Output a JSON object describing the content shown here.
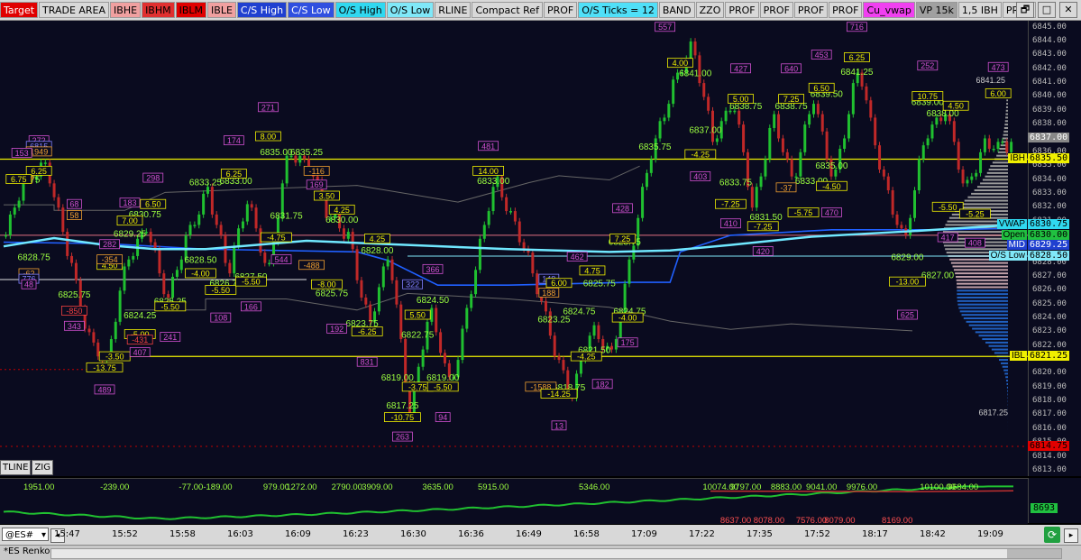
{
  "toolbar": [
    {
      "label": "Target",
      "bg": "#e00000",
      "fg": "#ffffff"
    },
    {
      "label": "TRADE AREA",
      "bg": "#d8d8d8",
      "fg": "#000"
    },
    {
      "label": "IBHE",
      "bg": "#f0a0a0",
      "fg": "#000"
    },
    {
      "label": "IBHM",
      "bg": "#e03030",
      "fg": "#000"
    },
    {
      "label": "IBLM",
      "bg": "#e00000",
      "fg": "#000"
    },
    {
      "label": "IBLE",
      "bg": "#f0a0a0",
      "fg": "#000"
    },
    {
      "label": "C/S High",
      "bg": "#2040d0",
      "fg": "#ffffff"
    },
    {
      "label": "C/S Low",
      "bg": "#3050e0",
      "fg": "#ffffff"
    },
    {
      "label": "O/S High",
      "bg": "#30d8f0",
      "fg": "#000"
    },
    {
      "label": "O/S Low",
      "bg": "#80e8f8",
      "fg": "#000"
    },
    {
      "label": "RLINE",
      "bg": "#d8d8d8",
      "fg": "#000"
    },
    {
      "label": "Compact Ref",
      "bg": "#d8d8d8",
      "fg": "#000"
    },
    {
      "label": "PROF",
      "bg": "#d8d8d8",
      "fg": "#000"
    },
    {
      "label": "O/S Ticks = 12",
      "bg": "#50e0f8",
      "fg": "#000"
    },
    {
      "label": "BAND",
      "bg": "#d8d8d8",
      "fg": "#000"
    },
    {
      "label": "ZZO",
      "bg": "#d8d8d8",
      "fg": "#000"
    },
    {
      "label": "PROF",
      "bg": "#d8d8d8",
      "fg": "#000"
    },
    {
      "label": "PROF",
      "bg": "#d8d8d8",
      "fg": "#000"
    },
    {
      "label": "PROF",
      "bg": "#d8d8d8",
      "fg": "#000"
    },
    {
      "label": "PROF",
      "bg": "#d8d8d8",
      "fg": "#000"
    },
    {
      "label": "Cu_vwap",
      "bg": "#f040f0",
      "fg": "#000"
    },
    {
      "label": "VP 15k",
      "bg": "#a0a0a0",
      "fg": "#000"
    },
    {
      "label": "1,5 IBH",
      "bg": "#d8d8d8",
      "fg": "#000"
    },
    {
      "label": "PROF",
      "bg": "#d8d8d8",
      "fg": "#000"
    }
  ],
  "window_controls": {
    "restore": "🗗",
    "maximize": "□",
    "close": "✕"
  },
  "price_axis": {
    "ticks": [
      "6845.00",
      "6844.00",
      "6843.00",
      "6842.00",
      "6841.00",
      "6840.00",
      "6839.00",
      "6838.00",
      "6837.00",
      "6836.00",
      "6835.00",
      "6834.00",
      "6833.00",
      "6832.00",
      "6831.00",
      "6830.00",
      "6829.00",
      "6828.00",
      "6827.00",
      "6826.00",
      "6825.00",
      "6824.00",
      "6823.00",
      "6822.00",
      "6821.00",
      "6820.00",
      "6819.00",
      "6818.00",
      "6817.00",
      "6816.00",
      "6815.00",
      "6814.00",
      "6813.00"
    ]
  },
  "price_labels": [
    {
      "tag": "",
      "value": "6837.00",
      "bg": "#888",
      "fg": "#fff",
      "price": 6837
    },
    {
      "tag": "IBH",
      "value": "6835.50",
      "bg": "#f0f000",
      "fg": "#000",
      "price": 6835.5
    },
    {
      "tag": "VWAP",
      "value": "6830.75",
      "bg": "#30d8f0",
      "fg": "#000",
      "price": 6830.75
    },
    {
      "tag": "Open",
      "value": "6830.00",
      "bg": "#20c040",
      "fg": "#000",
      "price": 6830
    },
    {
      "tag": "MID",
      "value": "6829.25",
      "bg": "#2040d0",
      "fg": "#fff",
      "price": 6829.25
    },
    {
      "tag": "O/S Low",
      "value": "6828.50",
      "bg": "#80e8f8",
      "fg": "#000",
      "price": 6828.5
    },
    {
      "tag": "IBL",
      "value": "6821.25",
      "bg": "#f0f000",
      "fg": "#000",
      "price": 6821.25
    },
    {
      "tag": "",
      "value": "6814.75",
      "bg": "#e00000",
      "fg": "#000",
      "price": 6814.75
    }
  ],
  "right_notes": {
    "high": "6841.25",
    "low": "6817.25"
  },
  "swing_labels": [
    {
      "text": "6835.00",
      "price": 6835.8,
      "t": 0.03
    },
    {
      "text": "6832.75",
      "price": 6833.8,
      "t": 0.02
    },
    {
      "text": "6829.25",
      "price": 6829.9,
      "t": 0.125
    },
    {
      "text": "6830.75",
      "price": 6831.3,
      "t": 0.14
    },
    {
      "text": "6828.75",
      "price": 6828.2,
      "t": 0.03
    },
    {
      "text": "6825.75",
      "price": 6825.5,
      "t": 0.07
    },
    {
      "text": "6824.25",
      "price": 6824.0,
      "t": 0.135
    },
    {
      "text": "6825.25",
      "price": 6825.0,
      "t": 0.165
    },
    {
      "text": "6833.25",
      "price": 6833.6,
      "t": 0.2
    },
    {
      "text": "6833.00",
      "price": 6833.7,
      "t": 0.23
    },
    {
      "text": "6828.50",
      "price": 6828.0,
      "t": 0.195
    },
    {
      "text": "6826.75",
      "price": 6826.3,
      "t": 0.22
    },
    {
      "text": "6827.50",
      "price": 6826.8,
      "t": 0.245
    },
    {
      "text": "6835.00",
      "price": 6835.8,
      "t": 0.27
    },
    {
      "text": "6835.25",
      "price": 6835.8,
      "t": 0.3
    },
    {
      "text": "6831.75",
      "price": 6831.2,
      "t": 0.28
    },
    {
      "text": "6830.00",
      "price": 6830.9,
      "t": 0.335
    },
    {
      "text": "6828.00",
      "price": 6828.7,
      "t": 0.37
    },
    {
      "text": "6825.75",
      "price": 6825.6,
      "t": 0.325
    },
    {
      "text": "6823.75",
      "price": 6823.4,
      "t": 0.355
    },
    {
      "text": "6833.00",
      "price": 6833.7,
      "t": 0.485
    },
    {
      "text": "6824.50",
      "price": 6825.1,
      "t": 0.425
    },
    {
      "text": "6822.75",
      "price": 6822.6,
      "t": 0.41
    },
    {
      "text": "6819.00",
      "price": 6819.5,
      "t": 0.39
    },
    {
      "text": "6819.00",
      "price": 6819.5,
      "t": 0.435
    },
    {
      "text": "6817.25",
      "price": 6817.5,
      "t": 0.395
    },
    {
      "text": "6825.75",
      "price": 6826.3,
      "t": 0.59
    },
    {
      "text": "6823.25",
      "price": 6823.7,
      "t": 0.545
    },
    {
      "text": "6824.75",
      "price": 6824.3,
      "t": 0.57
    },
    {
      "text": "6828.75",
      "price": 6829.3,
      "t": 0.615
    },
    {
      "text": "6824.75",
      "price": 6824.3,
      "t": 0.62
    },
    {
      "text": "6821.50",
      "price": 6821.5,
      "t": 0.585
    },
    {
      "text": "6818.75",
      "price": 6818.8,
      "t": 0.56
    },
    {
      "text": "6835.75",
      "price": 6836.2,
      "t": 0.645
    },
    {
      "text": "6841.00",
      "price": 6841.5,
      "t": 0.685
    },
    {
      "text": "6837.00",
      "price": 6837.4,
      "t": 0.695
    },
    {
      "text": "6838.75",
      "price": 6839.1,
      "t": 0.735
    },
    {
      "text": "6833.75",
      "price": 6833.6,
      "t": 0.725
    },
    {
      "text": "6831.50",
      "price": 6831.1,
      "t": 0.755
    },
    {
      "text": "6838.75",
      "price": 6839.1,
      "t": 0.78
    },
    {
      "text": "6839.50",
      "price": 6840.0,
      "t": 0.815
    },
    {
      "text": "6841.25",
      "price": 6841.6,
      "t": 0.845
    },
    {
      "text": "6835.00",
      "price": 6834.8,
      "t": 0.82
    },
    {
      "text": "6833.00",
      "price": 6833.7,
      "t": 0.8
    },
    {
      "text": "6839.00",
      "price": 6839.4,
      "t": 0.915
    },
    {
      "text": "6838.00",
      "price": 6838.6,
      "t": 0.93
    },
    {
      "text": "6829.00",
      "price": 6828.2,
      "t": 0.895
    },
    {
      "text": "6827.00",
      "price": 6826.9,
      "t": 0.925
    }
  ],
  "delta_boxes": [
    {
      "text": "272",
      "price": 6836.6,
      "t": 0.035,
      "c": "#d050d0"
    },
    {
      "text": "6815",
      "price": 6836.2,
      "t": 0.035,
      "c": "#8080ff"
    },
    {
      "text": "1949",
      "price": 6835.8,
      "t": 0.035,
      "c": "#f0a030"
    },
    {
      "text": "153",
      "price": 6835.7,
      "t": 0.018,
      "c": "#d050d0"
    },
    {
      "text": "6.25",
      "price": 6834.4,
      "t": 0.035,
      "c": "#f0f000"
    },
    {
      "text": "6.75",
      "price": 6833.8,
      "t": 0.015,
      "c": "#f0f000"
    },
    {
      "text": "68",
      "price": 6832.0,
      "t": 0.07,
      "c": "#d050d0"
    },
    {
      "text": "58",
      "price": 6831.2,
      "t": 0.07,
      "c": "#f0a030"
    },
    {
      "text": "-62",
      "price": 6827.0,
      "t": 0.025,
      "c": "#f0a030"
    },
    {
      "text": "776",
      "price": 6826.6,
      "t": 0.025,
      "c": "#8080ff"
    },
    {
      "text": "48",
      "price": 6826.2,
      "t": 0.025,
      "c": "#d050d0"
    },
    {
      "text": "-850",
      "price": 6824.3,
      "t": 0.07,
      "c": "#f04040"
    },
    {
      "text": "343",
      "price": 6823.2,
      "t": 0.07,
      "c": "#d050d0"
    },
    {
      "text": "282",
      "price": 6829.1,
      "t": 0.105,
      "c": "#d050d0"
    },
    {
      "text": "4.50",
      "price": 6827.6,
      "t": 0.105,
      "c": "#f0f000"
    },
    {
      "text": "-354",
      "price": 6828.0,
      "t": 0.105,
      "c": "#f0a030"
    },
    {
      "text": "183",
      "price": 6832.1,
      "t": 0.125,
      "c": "#d050d0"
    },
    {
      "text": "7.00",
      "price": 6830.8,
      "t": 0.125,
      "c": "#f0f000"
    },
    {
      "text": "298",
      "price": 6833.9,
      "t": 0.148,
      "c": "#d050d0"
    },
    {
      "text": "6.50",
      "price": 6832.0,
      "t": 0.148,
      "c": "#f0f000"
    },
    {
      "text": "-3.50",
      "price": 6821.0,
      "t": 0.11,
      "c": "#f0f000"
    },
    {
      "text": "-13.75",
      "price": 6820.2,
      "t": 0.1,
      "c": "#f0f000"
    },
    {
      "text": "489",
      "price": 6818.6,
      "t": 0.1,
      "c": "#d050d0"
    },
    {
      "text": "-5.00",
      "price": 6822.6,
      "t": 0.135,
      "c": "#f0f000"
    },
    {
      "text": "-431",
      "price": 6822.2,
      "t": 0.135,
      "c": "#f04040"
    },
    {
      "text": "407",
      "price": 6821.3,
      "t": 0.135,
      "c": "#d050d0"
    },
    {
      "text": "-5.50",
      "price": 6824.6,
      "t": 0.165,
      "c": "#f0f000"
    },
    {
      "text": "241",
      "price": 6822.4,
      "t": 0.165,
      "c": "#d050d0"
    },
    {
      "text": "-4.00",
      "price": 6827.0,
      "t": 0.195,
      "c": "#f0f000"
    },
    {
      "text": "-5.50",
      "price": 6825.8,
      "t": 0.215,
      "c": "#f0f000"
    },
    {
      "text": "108",
      "price": 6823.8,
      "t": 0.215,
      "c": "#d050d0"
    },
    {
      "text": "-5.50",
      "price": 6826.4,
      "t": 0.245,
      "c": "#f0f000"
    },
    {
      "text": "166",
      "price": 6824.6,
      "t": 0.245,
      "c": "#d050d0"
    },
    {
      "text": "174",
      "price": 6836.6,
      "t": 0.228,
      "c": "#d050d0"
    },
    {
      "text": "6.25",
      "price": 6834.2,
      "t": 0.228,
      "c": "#f0f000"
    },
    {
      "text": "271",
      "price": 6839.0,
      "t": 0.262,
      "c": "#d050d0"
    },
    {
      "text": "8.00",
      "price": 6836.9,
      "t": 0.262,
      "c": "#f0f000"
    },
    {
      "text": "-116",
      "price": 6834.4,
      "t": 0.31,
      "c": "#f0a030"
    },
    {
      "text": "169",
      "price": 6833.4,
      "t": 0.31,
      "c": "#d050d0"
    },
    {
      "text": "-4.75",
      "price": 6829.6,
      "t": 0.27,
      "c": "#f0f000"
    },
    {
      "text": "544",
      "price": 6828.0,
      "t": 0.275,
      "c": "#d050d0"
    },
    {
      "text": "-488",
      "price": 6827.6,
      "t": 0.305,
      "c": "#f0a030"
    },
    {
      "text": "3.50",
      "price": 6832.6,
      "t": 0.32,
      "c": "#f0f000"
    },
    {
      "text": "4.25",
      "price": 6831.6,
      "t": 0.335,
      "c": "#f0f000"
    },
    {
      "text": "4.25",
      "price": 6829.5,
      "t": 0.37,
      "c": "#f0f000"
    },
    {
      "text": "-8.00",
      "price": 6826.2,
      "t": 0.32,
      "c": "#f0f000"
    },
    {
      "text": "192",
      "price": 6823.0,
      "t": 0.33,
      "c": "#d050d0"
    },
    {
      "text": "-6.25",
      "price": 6822.8,
      "t": 0.36,
      "c": "#f0f000"
    },
    {
      "text": "831",
      "price": 6820.6,
      "t": 0.36,
      "c": "#d050d0"
    },
    {
      "text": "366",
      "price": 6827.3,
      "t": 0.425,
      "c": "#d050d0"
    },
    {
      "text": "322",
      "price": 6826.2,
      "t": 0.405,
      "c": "#8080ff"
    },
    {
      "text": "5.50",
      "price": 6824.0,
      "t": 0.41,
      "c": "#f0f000"
    },
    {
      "text": "-3.75",
      "price": 6818.8,
      "t": 0.41,
      "c": "#f0f000"
    },
    {
      "text": "-5.50",
      "price": 6818.8,
      "t": 0.435,
      "c": "#f0f000"
    },
    {
      "text": "-10.75",
      "price": 6816.6,
      "t": 0.395,
      "c": "#f0f000"
    },
    {
      "text": "94",
      "price": 6816.6,
      "t": 0.435,
      "c": "#d050d0"
    },
    {
      "text": "263",
      "price": 6815.2,
      "t": 0.395,
      "c": "#d050d0"
    },
    {
      "text": "481",
      "price": 6836.2,
      "t": 0.48,
      "c": "#d050d0"
    },
    {
      "text": "14.00",
      "price": 6834.4,
      "t": 0.48,
      "c": "#f0f000"
    },
    {
      "text": "148",
      "price": 6826.6,
      "t": 0.54,
      "c": "#8080ff"
    },
    {
      "text": "188",
      "price": 6825.6,
      "t": 0.54,
      "c": "#f0a030"
    },
    {
      "text": "462",
      "price": 6828.2,
      "t": 0.568,
      "c": "#d050d0"
    },
    {
      "text": "6.00",
      "price": 6826.3,
      "t": 0.55,
      "c": "#f0f000"
    },
    {
      "text": "4.75",
      "price": 6827.2,
      "t": 0.583,
      "c": "#f0f000"
    },
    {
      "text": "-4.25",
      "price": 6821.0,
      "t": 0.577,
      "c": "#f0f000"
    },
    {
      "text": "-1588",
      "price": 6818.8,
      "t": 0.532,
      "c": "#f0a030"
    },
    {
      "text": "-14.25",
      "price": 6818.3,
      "t": 0.55,
      "c": "#f0f000"
    },
    {
      "text": "13",
      "price": 6816.0,
      "t": 0.55,
      "c": "#d050d0"
    },
    {
      "text": "182",
      "price": 6819.0,
      "t": 0.593,
      "c": "#d050d0"
    },
    {
      "text": "-4.00",
      "price": 6823.8,
      "t": 0.618,
      "c": "#f0f000"
    },
    {
      "text": "175",
      "price": 6822.0,
      "t": 0.618,
      "c": "#d050d0"
    },
    {
      "text": "428",
      "price": 6831.7,
      "t": 0.613,
      "c": "#d050d0"
    },
    {
      "text": "7.25",
      "price": 6829.5,
      "t": 0.613,
      "c": "#f0f000"
    },
    {
      "text": "557",
      "price": 6844.8,
      "t": 0.655,
      "c": "#d050d0"
    },
    {
      "text": "4.00",
      "price": 6842.2,
      "t": 0.67,
      "c": "#f0f000"
    },
    {
      "text": "-4.25",
      "price": 6835.6,
      "t": 0.69,
      "c": "#f0f000"
    },
    {
      "text": "403",
      "price": 6834.0,
      "t": 0.69,
      "c": "#d050d0"
    },
    {
      "text": "427",
      "price": 6841.8,
      "t": 0.73,
      "c": "#d050d0"
    },
    {
      "text": "5.00",
      "price": 6839.6,
      "t": 0.73,
      "c": "#f0f000"
    },
    {
      "text": "-7.25",
      "price": 6832.0,
      "t": 0.72,
      "c": "#f0f000"
    },
    {
      "text": "410",
      "price": 6830.6,
      "t": 0.72,
      "c": "#d050d0"
    },
    {
      "text": "-7.25",
      "price": 6830.4,
      "t": 0.752,
      "c": "#f0f000"
    },
    {
      "text": "420",
      "price": 6828.6,
      "t": 0.752,
      "c": "#d050d0"
    },
    {
      "text": "640",
      "price": 6841.8,
      "t": 0.78,
      "c": "#d050d0"
    },
    {
      "text": "7.25",
      "price": 6839.6,
      "t": 0.78,
      "c": "#f0f000"
    },
    {
      "text": "-5.75",
      "price": 6831.4,
      "t": 0.792,
      "c": "#f0f000"
    },
    {
      "text": "-37",
      "price": 6833.2,
      "t": 0.775,
      "c": "#f0a030"
    },
    {
      "text": "-4.50",
      "price": 6833.3,
      "t": 0.82,
      "c": "#f0f000"
    },
    {
      "text": "470",
      "price": 6831.4,
      "t": 0.82,
      "c": "#d050d0"
    },
    {
      "text": "453",
      "price": 6842.8,
      "t": 0.81,
      "c": "#d050d0"
    },
    {
      "text": "6.50",
      "price": 6840.4,
      "t": 0.81,
      "c": "#f0f000"
    },
    {
      "text": "716",
      "price": 6844.8,
      "t": 0.845,
      "c": "#d050d0"
    },
    {
      "text": "6.25",
      "price": 6842.6,
      "t": 0.845,
      "c": "#f0f000"
    },
    {
      "text": "252",
      "price": 6842.0,
      "t": 0.915,
      "c": "#d050d0"
    },
    {
      "text": "10.75",
      "price": 6839.8,
      "t": 0.915,
      "c": "#f0f000"
    },
    {
      "text": "4.50",
      "price": 6839.1,
      "t": 0.943,
      "c": "#f0f000"
    },
    {
      "text": "-13.00",
      "price": 6826.4,
      "t": 0.895,
      "c": "#f0f000"
    },
    {
      "text": "625",
      "price": 6824.0,
      "t": 0.895,
      "c": "#d050d0"
    },
    {
      "text": "-5.50",
      "price": 6831.8,
      "t": 0.935,
      "c": "#f0f000"
    },
    {
      "text": "417",
      "price": 6829.6,
      "t": 0.935,
      "c": "#d050d0"
    },
    {
      "text": "-5.25",
      "price": 6831.3,
      "t": 0.962,
      "c": "#f0f000"
    },
    {
      "text": "408",
      "price": 6829.2,
      "t": 0.962,
      "c": "#d050d0"
    },
    {
      "text": "473",
      "price": 6841.9,
      "t": 0.985,
      "c": "#d050d0"
    },
    {
      "text": "6.00",
      "price": 6840.0,
      "t": 0.985,
      "c": "#f0f000"
    }
  ],
  "indicator": {
    "values": [
      {
        "text": "1951.00",
        "t": 0.035
      },
      {
        "text": "-239.00",
        "t": 0.11
      },
      {
        "text": "-77.00-189.00",
        "t": 0.2
      },
      {
        "text": "979.00",
        "t": 0.27
      },
      {
        "text": "1272.00",
        "t": 0.295
      },
      {
        "text": "2790.00",
        "t": 0.34
      },
      {
        "text": "3909.00",
        "t": 0.37
      },
      {
        "text": "3635.00",
        "t": 0.43
      },
      {
        "text": "5915.00",
        "t": 0.485
      },
      {
        "text": "5346.00",
        "t": 0.585
      },
      {
        "text": "10074.00",
        "t": 0.71
      },
      {
        "text": "9797.00",
        "t": 0.735
      },
      {
        "text": "8883.00",
        "t": 0.775
      },
      {
        "text": "9041.00",
        "t": 0.81
      },
      {
        "text": "9976.00",
        "t": 0.85
      },
      {
        "text": "10100.00",
        "t": 0.925
      },
      {
        "text": "9684.00",
        "t": 0.95
      }
    ],
    "lows": [
      {
        "text": "8637.00",
        "t": 0.725
      },
      {
        "text": "8078.00",
        "t": 0.758
      },
      {
        "text": "7576.00",
        "t": 0.8
      },
      {
        "text": "8079.00",
        "t": 0.828
      },
      {
        "text": "8169.00",
        "t": 0.885
      }
    ],
    "current": "8693"
  },
  "time_axis": [
    "15:47",
    "15:52",
    "15:58",
    "16:03",
    "16:09",
    "16:23",
    "16:30",
    "16:36",
    "16:49",
    "16:58",
    "17:09",
    "17:22",
    "17:35",
    "17:52",
    "18:17",
    "18:42",
    "19:09"
  ],
  "lower_left_buttons": [
    "TLINE",
    "ZIG"
  ],
  "status": {
    "symbol": "@ES#",
    "symbol_desc": "*ES Renko"
  },
  "colors": {
    "ibh": "#f0f000",
    "vwap": "#70e8ff",
    "os_low": "#80e8f8",
    "mid": "#2060ff",
    "red_target": "#e00000"
  }
}
